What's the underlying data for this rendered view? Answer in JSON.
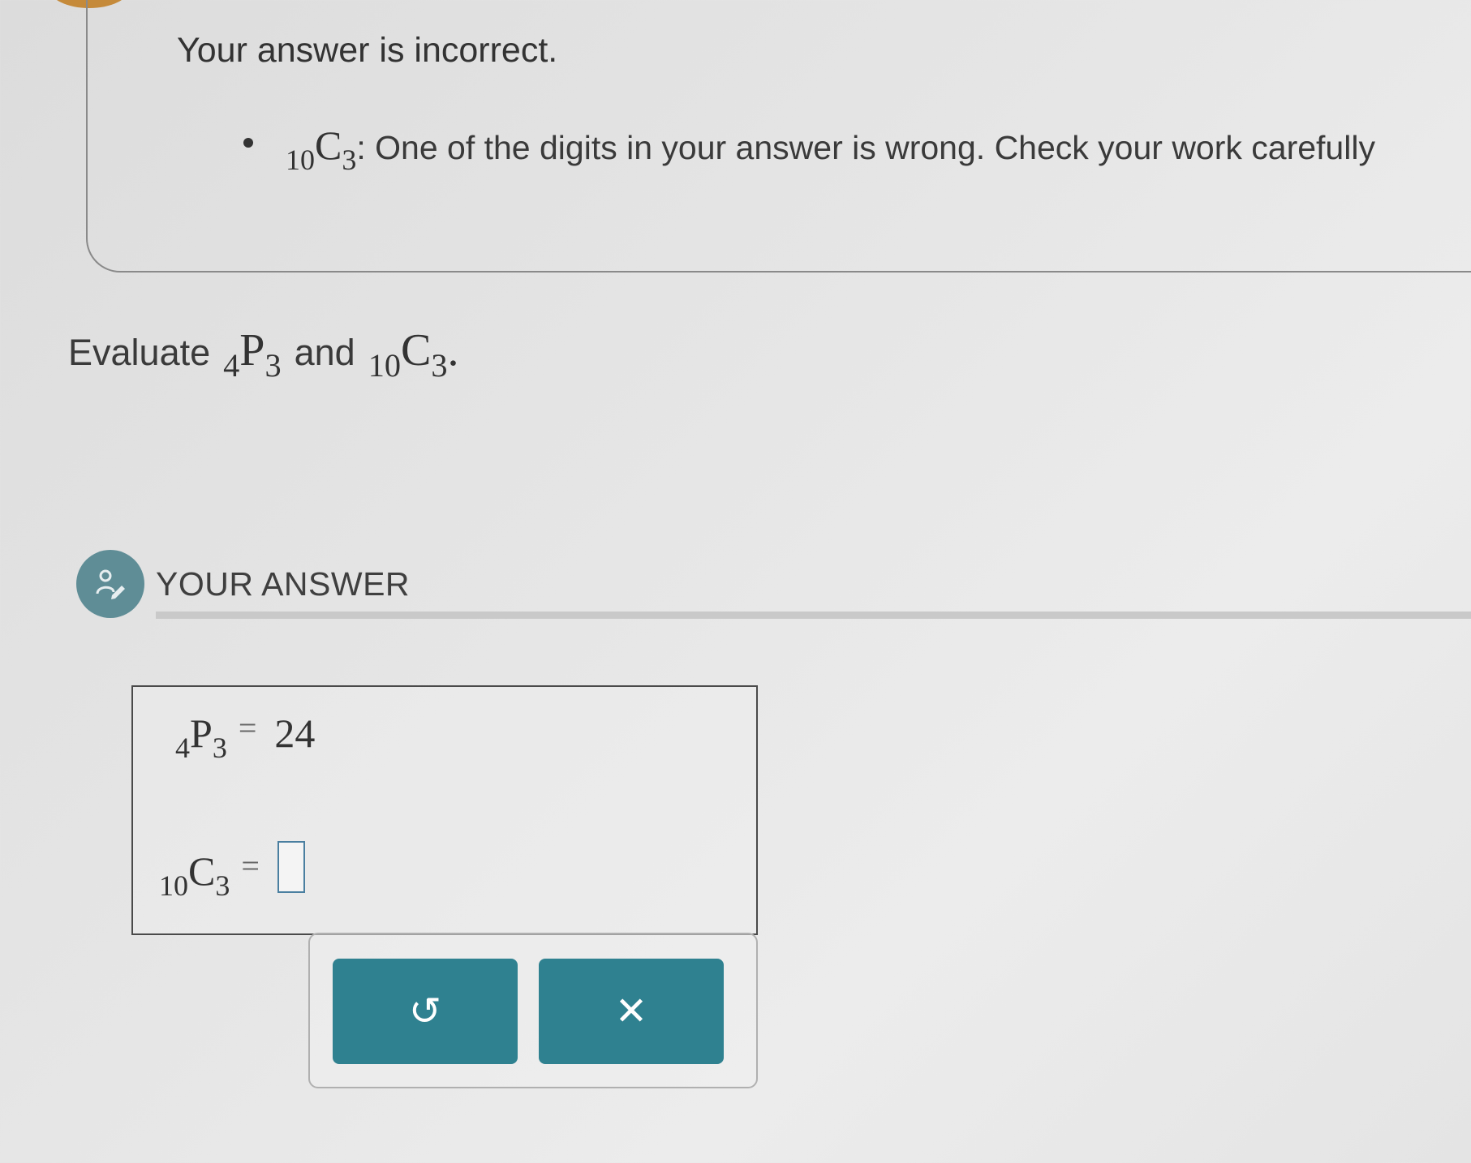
{
  "feedback": {
    "title": "Your answer is incorrect.",
    "item_expr": {
      "pre": "10",
      "letter": "C",
      "sub": "3"
    },
    "item_message": ": One of the digits in your answer is wrong. Check your work carefully"
  },
  "question": {
    "prefix": "Evaluate",
    "expr1": {
      "pre": "4",
      "letter": "P",
      "sub": "3"
    },
    "connector": "and",
    "expr2": {
      "pre": "10",
      "letter": "C",
      "sub": "3"
    },
    "suffix": "."
  },
  "answer_section": {
    "label": "YOUR ANSWER",
    "avatar_icon": "person-pencil-icon",
    "rows": [
      {
        "pre": "4",
        "letter": "P",
        "sub": "3",
        "equals": "=",
        "value": "24"
      },
      {
        "pre": "10",
        "letter": "C",
        "sub": "3",
        "equals": "=",
        "value": ""
      }
    ]
  },
  "buttons": {
    "undo_icon": "undo-icon",
    "undo_glyph": "↺",
    "clear_icon": "close-icon",
    "clear_glyph": "✕"
  },
  "colors": {
    "button_bg": "#2f8190",
    "avatar_bg": "#5f8d96",
    "accent": "#c58a3a"
  }
}
